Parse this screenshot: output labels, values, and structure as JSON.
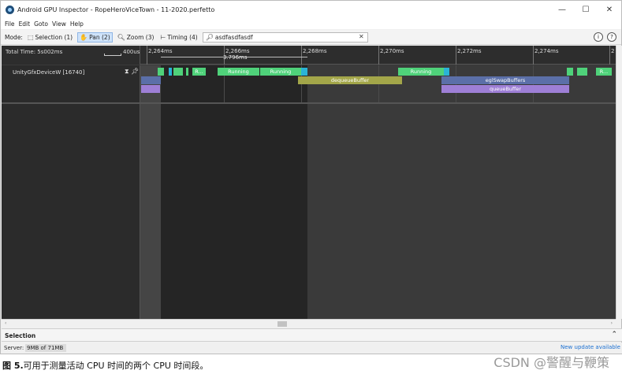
{
  "window": {
    "title": "Android GPU Inspector - RopeHeroViceTown - 11-2020.perfetto",
    "controls": {
      "minimize": "—",
      "maximize": "☐",
      "close": "✕"
    }
  },
  "menu": [
    "File",
    "Edit",
    "Goto",
    "View",
    "Help"
  ],
  "toolbar": {
    "mode_label": "Mode:",
    "modes": [
      {
        "label": "Selection (1)",
        "icon": "selection-icon",
        "glyph": "⬚",
        "active": false
      },
      {
        "label": "Pan (2)",
        "icon": "hand-icon",
        "glyph": "✋",
        "active": true
      },
      {
        "label": "Zoom (3)",
        "icon": "zoom-icon",
        "glyph": "🔍︎",
        "active": false
      },
      {
        "label": "Timing (4)",
        "icon": "timing-icon",
        "glyph": "⊢",
        "active": false
      }
    ],
    "search_value": "asdfasdfasdf",
    "search_icon": "🔎︎",
    "clear": "✕",
    "info_btn": "i",
    "help_btn": "?"
  },
  "timeline": {
    "total_time": "Total Time: 5s002ms",
    "scale": "400us",
    "ticks": [
      "2,264ms",
      "2,266ms",
      "2,268ms",
      "2,270ms",
      "2,272ms",
      "2,274ms",
      "2"
    ],
    "measure": "3.796ms"
  },
  "track": {
    "name": "UnityGfxDeviceW [16740]",
    "icons": "⧗ 📌︎",
    "slices_row1": [
      "R...",
      "Running",
      "Running",
      "Running",
      "R..."
    ],
    "slices_row2": [
      "dequeueBuffer",
      "eglSwapBuffers"
    ],
    "slices_row3": [
      "queueBuffer"
    ]
  },
  "selection_panel": {
    "title": "Selection",
    "chevron": "⌃"
  },
  "status": {
    "server_label": "Server:",
    "server_mem": "9MB of 71MB",
    "update": "New update available"
  },
  "caption": {
    "bold": "图 5.",
    "text": "可用于测量活动 CPU 时间的两个 CPU 时间段。"
  },
  "watermark": "CSDN @警醒与鞭策",
  "colors": {
    "running": "#4fd27a",
    "running_dark": "#3bb462",
    "cyan": "#2ab3d6",
    "deque": "#a3a649",
    "egl": "#5b6fa8",
    "queue": "#9e7fd6",
    "purple": "#8b7cc8"
  }
}
